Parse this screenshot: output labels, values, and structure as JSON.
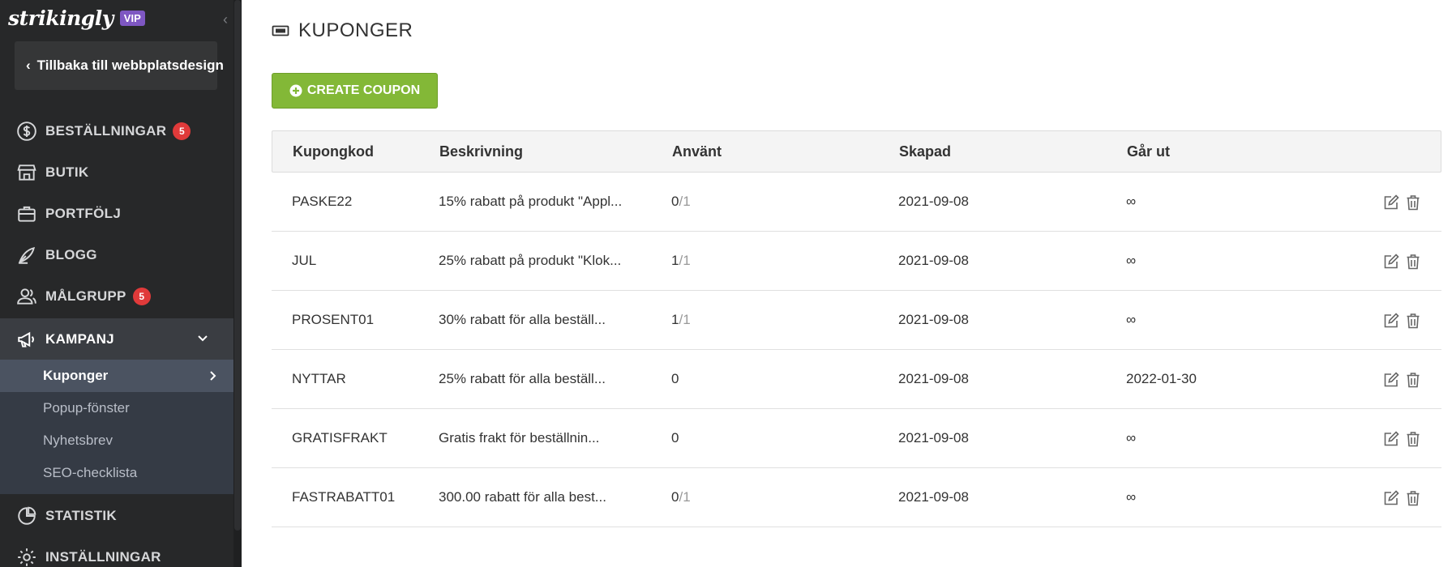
{
  "sidebar": {
    "logo": "strikingly",
    "vip_badge": "VIP",
    "back_label": "Tillbaka till webbplatsdesign",
    "nav": [
      {
        "label": "BESTÄLLNINGAR",
        "badge": "5"
      },
      {
        "label": "BUTIK"
      },
      {
        "label": "PORTFÖLJ"
      },
      {
        "label": "BLOGG"
      },
      {
        "label": "MÅLGRUPP",
        "badge": "5"
      },
      {
        "label": "KAMPANJ"
      }
    ],
    "subnav": [
      "Kuponger",
      "Popup-fönster",
      "Nyhetsbrev",
      "SEO-checklista"
    ],
    "nav_bottom": [
      {
        "label": "STATISTIK"
      },
      {
        "label": "INSTÄLLNINGAR"
      }
    ]
  },
  "main": {
    "title": "KUPONGER",
    "create_button": "CREATE COUPON",
    "columns": [
      "Kupongkod",
      "Beskrivning",
      "Använt",
      "Skapad",
      "Går ut"
    ],
    "rows": [
      {
        "code": "PASKE22",
        "description": "15% rabatt på produkt \"Appl...",
        "used": "0",
        "limit": "/1",
        "created": "2021-09-08",
        "expires": "∞"
      },
      {
        "code": "JUL",
        "description": "25% rabatt på produkt \"Klok...",
        "used": "1",
        "limit": "/1",
        "created": "2021-09-08",
        "expires": "∞"
      },
      {
        "code": "PROSENT01",
        "description": "30% rabatt för alla beställ...",
        "used": "1",
        "limit": "/1",
        "created": "2021-09-08",
        "expires": "∞"
      },
      {
        "code": "NYTTAR",
        "description": "25% rabatt för alla beställ...",
        "used": "0",
        "limit": "",
        "created": "2021-09-08",
        "expires": "2022-01-30"
      },
      {
        "code": "GRATISFRAKT",
        "description": "Gratis frakt för beställnin...",
        "used": "0",
        "limit": "",
        "created": "2021-09-08",
        "expires": "∞"
      },
      {
        "code": "FASTRABATT01",
        "description": "300.00 rabatt för alla best...",
        "used": "0",
        "limit": "/1",
        "created": "2021-09-08",
        "expires": "∞"
      }
    ]
  },
  "colors": {
    "sidebar_bg": "#272829",
    "subnav_bg": "#353b45",
    "active_subnav_bg": "#4b5361",
    "badge_red": "#e03a3a",
    "vip_purple": "#7e57c2",
    "create_green": "#83b837"
  }
}
